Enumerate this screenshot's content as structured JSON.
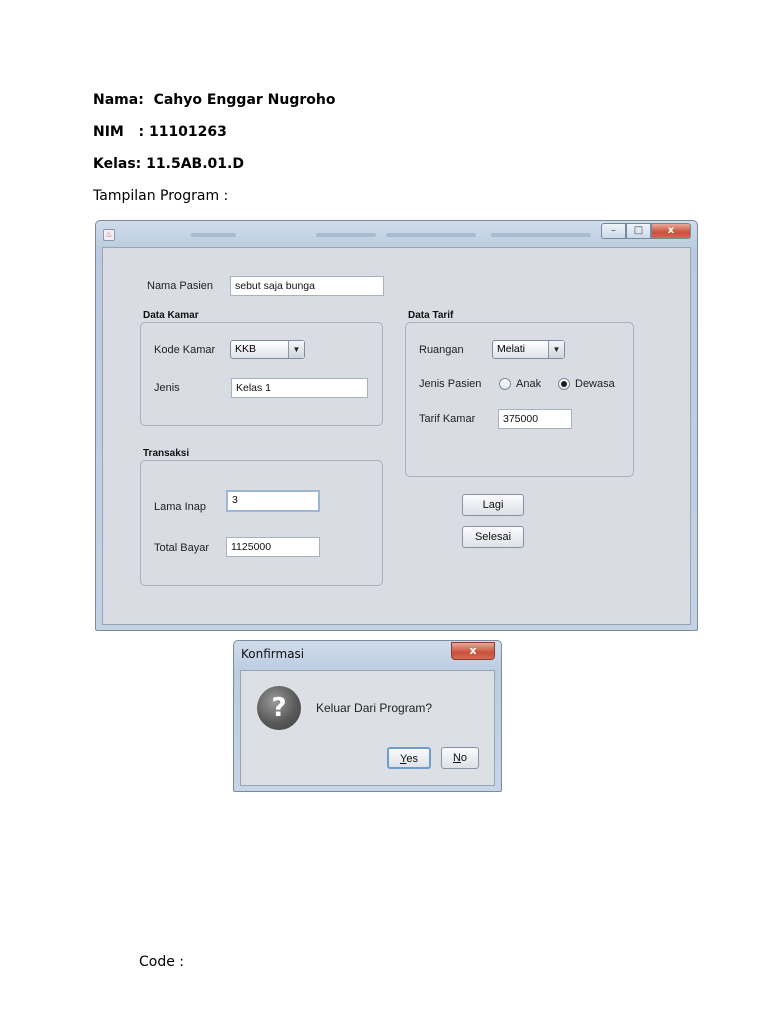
{
  "header": {
    "nama_label": "Nama:",
    "nama_value": "Cahyo Enggar Nugroho",
    "nim_label": "NIM",
    "nim_value": ": 11101263",
    "kelas_label": "Kelas:",
    "kelas_value": "11.5AB.01.D",
    "tampilan": "Tampilan Program :"
  },
  "window": {
    "close_glyph": "x",
    "minimize_glyph": "–",
    "maximize_glyph": "□",
    "nama_pasien_label": "Nama Pasien",
    "nama_pasien_value": "sebut saja bunga",
    "data_kamar_title": "Data Kamar",
    "kode_kamar_label": "Kode Kamar",
    "kode_kamar_value": "KKB",
    "jenis_label": "Jenis",
    "jenis_value": "Kelas 1",
    "transaksi_title": "Transaksi",
    "lama_inap_label": "Lama Inap",
    "lama_inap_value": "3",
    "total_bayar_label": "Total Bayar",
    "total_bayar_value": "1125000",
    "data_tarif_title": "Data Tarif",
    "ruangan_label": "Ruangan",
    "ruangan_value": "Melati",
    "jenis_pasien_label": "Jenis Pasien",
    "radio_anak": "Anak",
    "radio_dewasa": "Dewasa",
    "tarif_kamar_label": "Tarif Kamar",
    "tarif_kamar_value": "375000",
    "btn_lagi": "Lagi",
    "btn_selesai": "Selesai"
  },
  "dialog": {
    "title": "Konfirmasi",
    "close_glyph": "x",
    "icon": "question-icon",
    "message": "Keluar Dari Program?",
    "yes_mnemonic": "Y",
    "yes_rest": "es",
    "no_mnemonic": "N",
    "no_rest": "o"
  },
  "footer": {
    "code_label": "Code :"
  }
}
